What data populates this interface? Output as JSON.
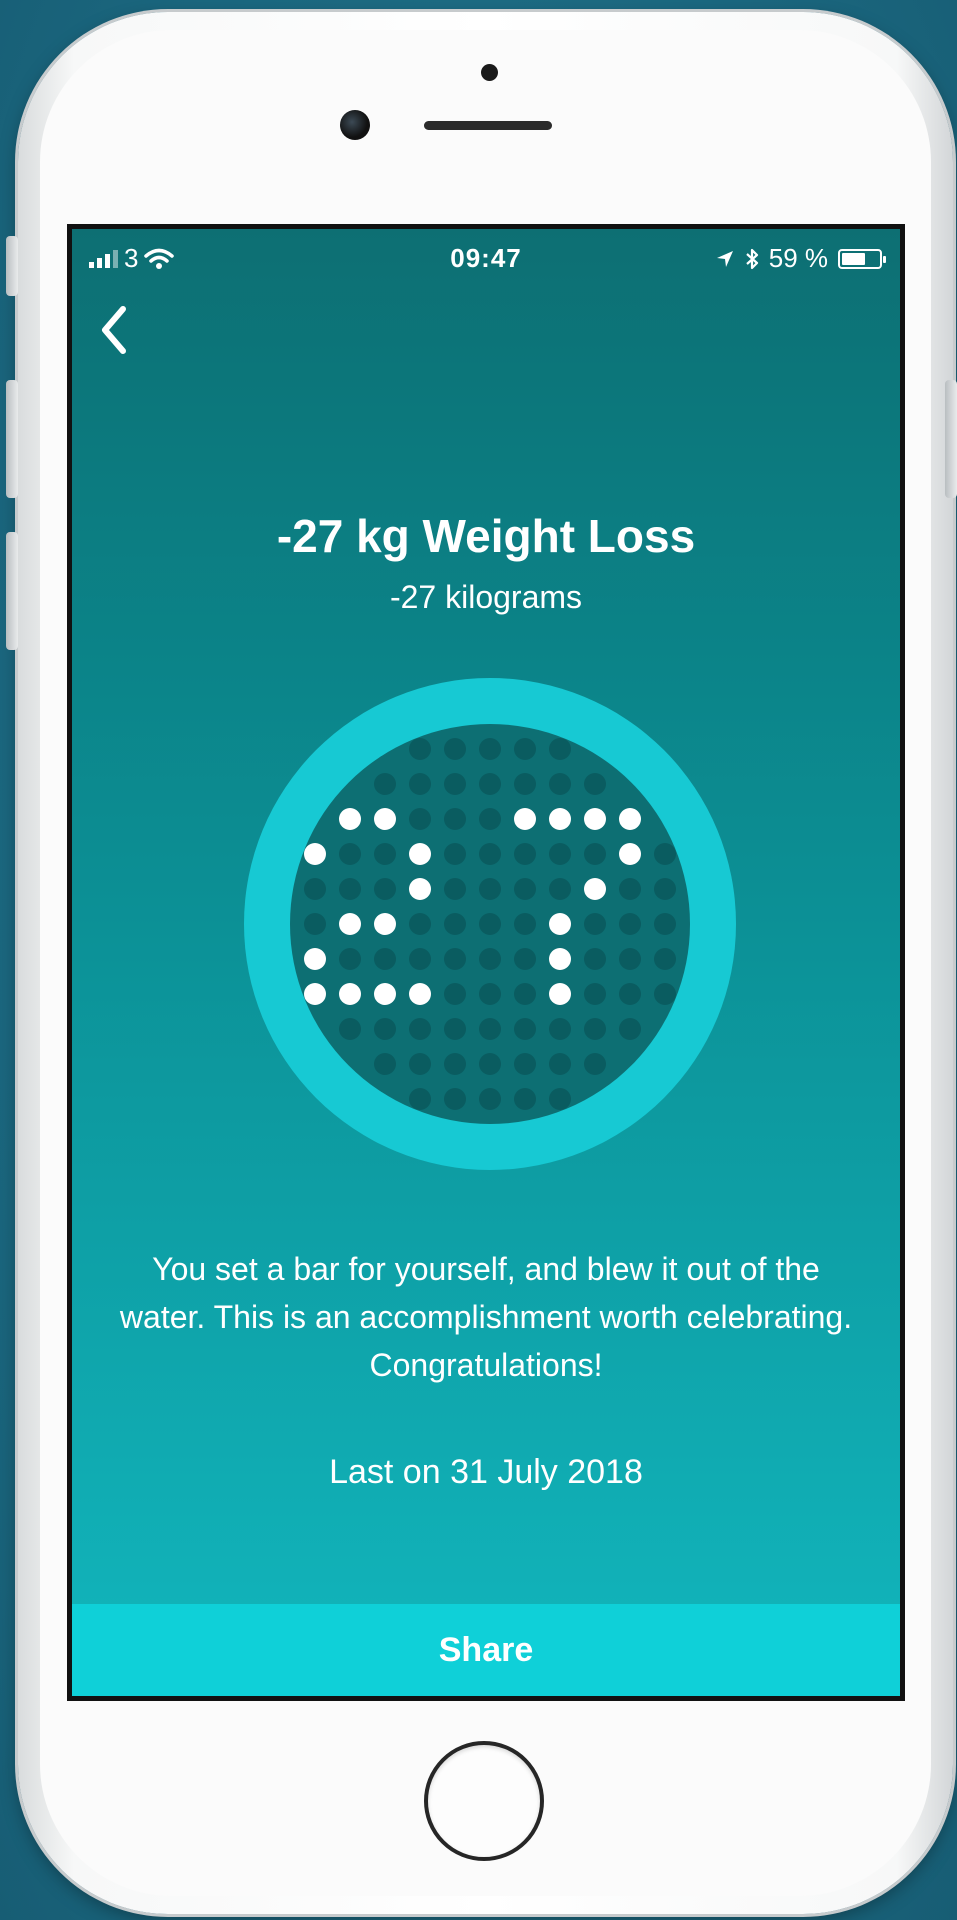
{
  "status_bar": {
    "carrier": "3",
    "time": "09:47",
    "battery": "59 %"
  },
  "screen": {
    "title": "-27 kg Weight Loss",
    "subtitle": "-27 kilograms",
    "badge_number": "27",
    "message": "You set a bar for yourself, and blew it out of the water. This is an accomplishment worth celebrating. Congratulations!",
    "last_on": "Last on 31 July 2018",
    "share_label": "Share"
  },
  "colors": {
    "gradient_top": "#0d6f73",
    "gradient_bottom": "#12b6bd",
    "badge_ring": "#17c9d3",
    "badge_face": "#0d6f73",
    "share_bar": "#0fd0d8"
  },
  "icons": {
    "back": "chevron-left-icon",
    "wifi": "wifi-icon",
    "location": "location-arrow-icon",
    "bluetooth": "bluetooth-icon",
    "battery": "battery-icon"
  }
}
